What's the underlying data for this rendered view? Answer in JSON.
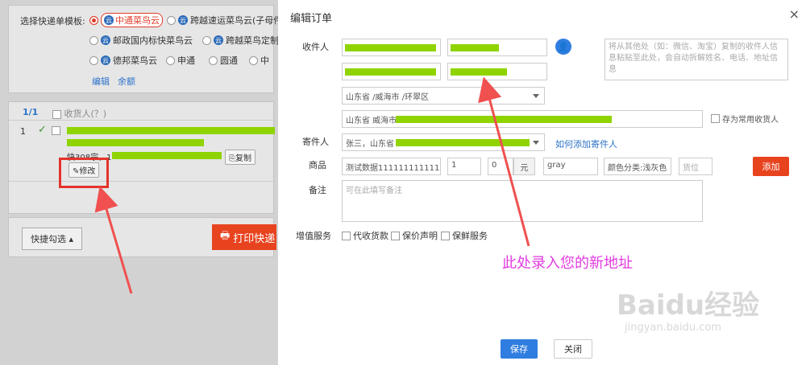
{
  "background": {
    "template_label": "选择快递单模板:",
    "templates": [
      {
        "name": "中通菜鸟云",
        "selected": true
      },
      {
        "name": "跨越速运菜鸟云(子母件",
        "selected": false
      },
      {
        "name": "邮政国内标快菜鸟云",
        "selected": false
      },
      {
        "name": "跨越菜鸟定制",
        "selected": false
      },
      {
        "name": "德邦菜鸟云",
        "selected": false
      },
      {
        "name": "申通",
        "selected": false
      },
      {
        "name": "圆通",
        "selected": false
      },
      {
        "name": "中",
        "selected": false
      }
    ],
    "edit_link": "编辑",
    "balance_link": "余额",
    "list_count": "1/1",
    "recipient_header": "收货人(？)",
    "row_number": "1",
    "row_text": "快308宗，1",
    "copy_button": "复制",
    "modify_button": "修改",
    "quick_select": "快捷勾选",
    "print_button": "打印快递"
  },
  "modal": {
    "title": "编辑订单",
    "close": "×",
    "recipient_label": "收件人",
    "recipient_region": "山东省 /威海市 /环翠区",
    "recipient_address_prefix": "山东省 威海市",
    "paste_placeholder": "将从其他处（如：微信、淘宝）复制的收件人信息粘贴至此处，会自动拆解姓名、电话、地址信息",
    "save_common": "存为常用收货人",
    "sender_label": "寄件人",
    "sender_value": "张三，山东省",
    "add_sender_link": "如何添加寄件人",
    "goods_label": "商品",
    "goods_name": "测试数据111111111111111",
    "goods_qty": "1",
    "goods_price": "0",
    "price_unit": "元",
    "goods_color": "gray",
    "goods_spec": "颜色分类:浅灰色",
    "goods_code_placeholder": "货位",
    "add_button": "添加",
    "remark_label": "备注",
    "remark_placeholder": "可在此填写备注",
    "value_added_label": "增值服务",
    "services": [
      "代收货款",
      "保价声明",
      "保鲜服务"
    ],
    "save_button": "保存",
    "close_button": "关闭"
  },
  "annotation_text": "此处录入您的新地址",
  "watermark": {
    "brand": "Baidu经验",
    "url": "jingyan.baidu.com"
  }
}
